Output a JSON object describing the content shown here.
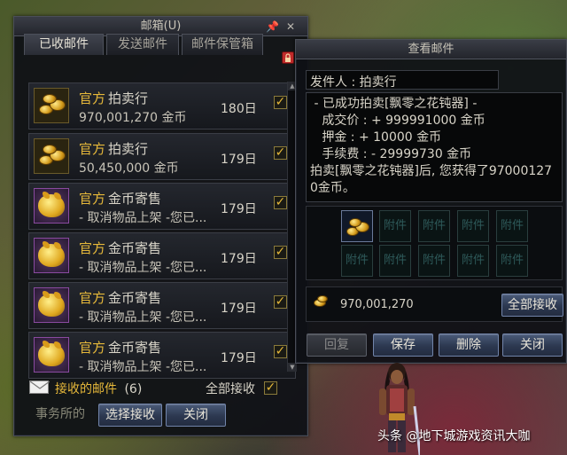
{
  "mailbox": {
    "title": "邮箱(U)",
    "tabs": [
      "已收邮件",
      "发送邮件",
      "邮件保管箱"
    ],
    "active_tab": 0,
    "items": [
      {
        "official": "官方",
        "sender": "拍卖行",
        "sub": "970,001,270 金币",
        "days": "180日",
        "icon": "gold-coins-icon",
        "checked": true
      },
      {
        "official": "官方",
        "sender": "拍卖行",
        "sub": "50,450,000 金币",
        "days": "179日",
        "icon": "gold-coins-icon",
        "checked": true
      },
      {
        "official": "官方",
        "sender": "金币寄售",
        "sub": "- 取消物品上架 -您已...",
        "days": "179日",
        "icon": "gold-pig-icon",
        "checked": true
      },
      {
        "official": "官方",
        "sender": "金币寄售",
        "sub": "- 取消物品上架 -您已...",
        "days": "179日",
        "icon": "gold-pig-icon",
        "checked": true
      },
      {
        "official": "官方",
        "sender": "金币寄售",
        "sub": "- 取消物品上架 -您已...",
        "days": "179日",
        "icon": "gold-pig-icon",
        "checked": true
      },
      {
        "official": "官方",
        "sender": "金币寄售",
        "sub": "- 取消物品上架 -您已...",
        "days": "179日",
        "icon": "gold-pig-icon",
        "checked": true
      }
    ],
    "received_label": "接收的邮件",
    "received_count": "(6)",
    "receive_all_label": "全部接收",
    "receive_all_checked": true,
    "select_receive_button": "选择接收",
    "close_button": "关闭",
    "background_text": "事务所的"
  },
  "viewmail": {
    "title": "查看邮件",
    "sender_line": "发件人 : 拍卖行",
    "body": " - 已成功拍卖[飘零之花钝器] -\n   成交价 : + 999991000 金币\n   押金 : + 10000 金币\n   手续费 : - 29999730 金币\n拍卖[飘零之花钝器]后, 您获得了97000127\n0金币。",
    "attachment_placeholder": "附件",
    "gold_amount": "970,001,270",
    "receive_all_button": "全部接收",
    "reply_button": "回复",
    "save_button": "保存",
    "delete_button": "删除",
    "close_button": "关闭"
  },
  "watermark": "头条 @地下城游戏资讯大咖",
  "colors": {
    "official": "#e6b83a",
    "checkbox": "#e6b83a",
    "button_border": "#7184aa"
  }
}
